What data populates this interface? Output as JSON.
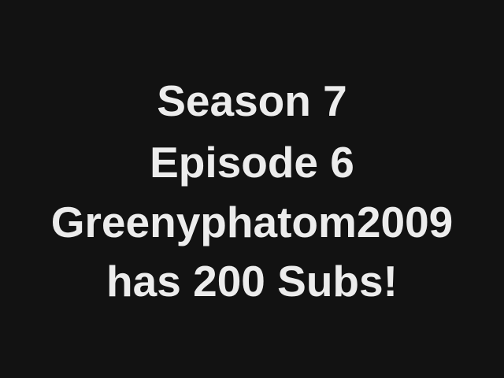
{
  "title_card": {
    "background_color": "#121212",
    "text_color": "#ececec",
    "lines": [
      "Season 7",
      "Episode 6",
      "Greenyphatom2009",
      "has 200 Subs!"
    ]
  }
}
